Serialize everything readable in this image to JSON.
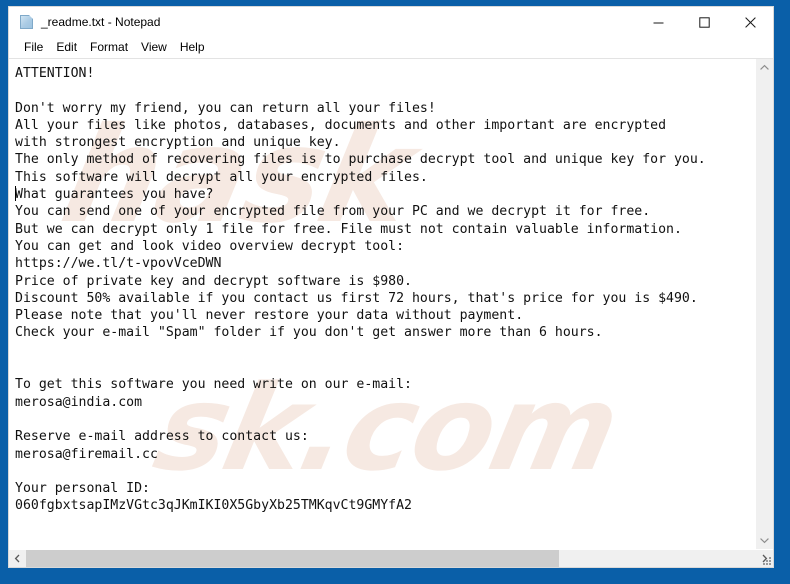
{
  "window": {
    "title": "_readme.txt - Notepad",
    "icon": "notepad-document-icon",
    "frame_color": "#0a5fa8",
    "controls": {
      "minimize": "Minimize",
      "maximize": "Maximize",
      "close": "Close"
    }
  },
  "menubar": {
    "items": [
      {
        "label": "File"
      },
      {
        "label": "Edit"
      },
      {
        "label": "Format"
      },
      {
        "label": "View"
      },
      {
        "label": "Help"
      }
    ]
  },
  "editor": {
    "watermark_1": "hask",
    "watermark_2": "sk.com",
    "content": "ATTENTION!\n\nDon't worry my friend, you can return all your files!\nAll your files like photos, databases, documents and other important are encrypted\nwith strongest encryption and unique key.\nThe only method of recovering files is to purchase decrypt tool and unique key for you.\nThis software will decrypt all your encrypted files.\nWhat guarantees you have?\nYou can send one of your encrypted file from your PC and we decrypt it for free.\nBut we can decrypt only 1 file for free. File must not contain valuable information.\nYou can get and look video overview decrypt tool:\nhttps://we.tl/t-vpovVceDWN\nPrice of private key and decrypt software is $980.\nDiscount 50% available if you contact us first 72 hours, that's price for you is $490.\nPlease note that you'll never restore your data without payment.\nCheck your e-mail \"Spam\" folder if you don't get answer more than 6 hours.\n\n\nTo get this software you need write on our e-mail:\nmerosa@india.com\n\nReserve e-mail address to contact us:\nmerosa@firemail.cc\n\nYour personal ID:\n060fgbxtsapIMzVGtc3qJKmIKI0X5GbyXb25TMKqvCt9GMYfA2",
    "details": {
      "heading": "ATTENTION!",
      "video_url": "https://we.tl/t-vpovVceDWN",
      "price": "$980",
      "discount_percent": "50%",
      "discount_window": "72 hours",
      "discount_price": "$490",
      "spam_answer_hours": "6 hours",
      "free_decrypt_files": "1 file",
      "primary_email": "merosa@india.com",
      "reserve_email": "merosa@firemail.cc",
      "personal_id": "060fgbxtsapIMzVGtc3qJKmIKI0X5GbyXb25TMKqvCt9GMYfA2"
    }
  },
  "scrollbars": {
    "vertical": {
      "up_arrow": "scroll-up",
      "down_arrow": "scroll-down"
    },
    "horizontal": {
      "left_arrow": "scroll-left",
      "right_arrow": "scroll-right",
      "thumb_fraction": "73%"
    }
  }
}
